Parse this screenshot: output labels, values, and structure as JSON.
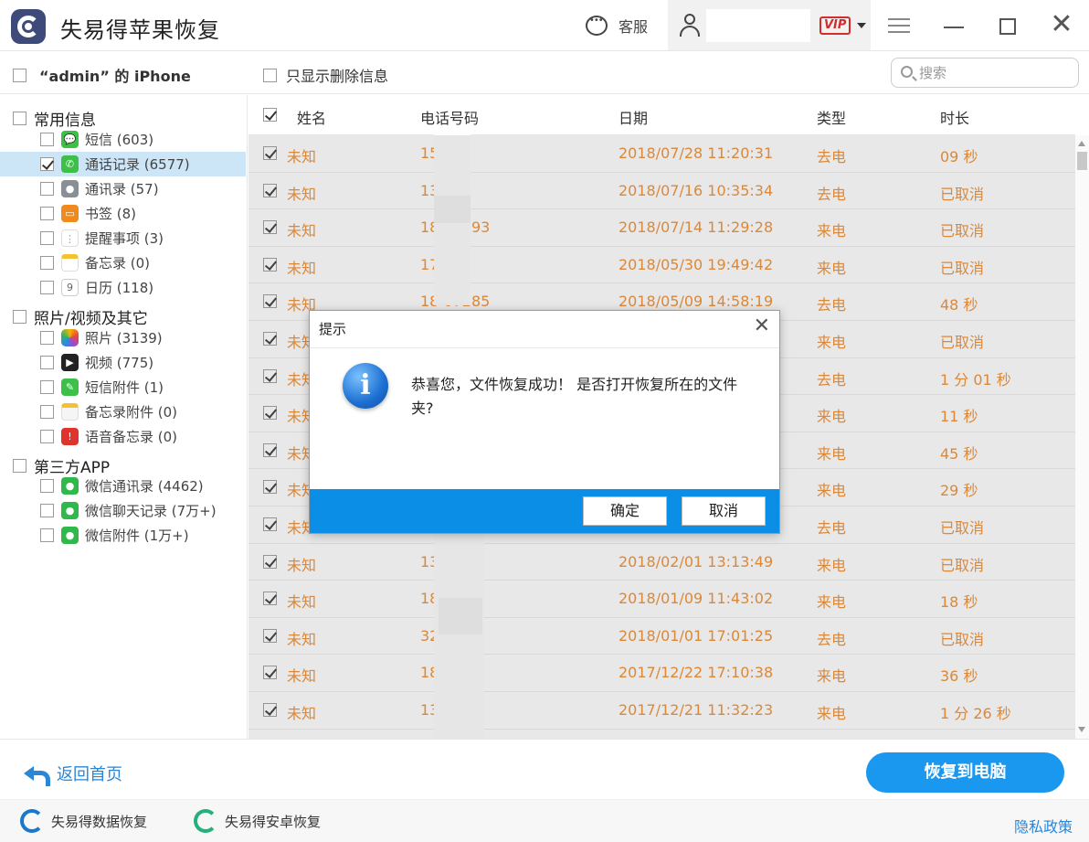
{
  "app": {
    "title": "失易得苹果恢复",
    "service_label": "客服",
    "vip_label": "VIP"
  },
  "toolbar": {
    "device_label": "“admin” 的 iPhone",
    "only_deleted_label": "只显示删除信息",
    "search_placeholder": "搜索"
  },
  "sidebar": {
    "groups": [
      {
        "label": "常用信息"
      },
      {
        "label": "照片/视频及其它"
      },
      {
        "label": "第三方APP"
      }
    ],
    "items": [
      {
        "label": "短信 (603)",
        "icon": "messages-icon",
        "checked": false
      },
      {
        "label": "通话记录 (6577)",
        "icon": "phone-icon",
        "checked": true,
        "selected": true
      },
      {
        "label": "通讯录 (57)",
        "icon": "contacts-icon",
        "checked": false
      },
      {
        "label": "书签 (8)",
        "icon": "bookmark-icon",
        "checked": false
      },
      {
        "label": "提醒事项 (3)",
        "icon": "reminders-icon",
        "checked": false
      },
      {
        "label": "备忘录 (0)",
        "icon": "notes-icon",
        "checked": false
      },
      {
        "label": "日历 (118)",
        "icon": "calendar-icon",
        "checked": false
      },
      {
        "label": "照片 (3139)",
        "icon": "photos-icon",
        "checked": false
      },
      {
        "label": "视频 (775)",
        "icon": "video-icon",
        "checked": false
      },
      {
        "label": "短信附件 (1)",
        "icon": "attachment-icon",
        "checked": false
      },
      {
        "label": "备忘录附件 (0)",
        "icon": "notes-attachment-icon",
        "checked": false
      },
      {
        "label": "语音备忘录 (0)",
        "icon": "voice-memo-icon",
        "checked": false
      },
      {
        "label": "微信通讯录 (4462)",
        "icon": "wechat-contacts-icon",
        "checked": false
      },
      {
        "label": "微信聊天记录 (7万+)",
        "icon": "wechat-chat-icon",
        "checked": false
      },
      {
        "label": "微信附件 (1万+)",
        "icon": "wechat-attachment-icon",
        "checked": false
      }
    ]
  },
  "table": {
    "headers": {
      "name": "姓名",
      "phone": "电话号码",
      "date": "日期",
      "type": "类型",
      "duration": "时长"
    },
    "rows": [
      {
        "name": "未知",
        "phone": "15      91",
        "date": "2018/07/28 11:20:31",
        "type": "去电",
        "duration": "09 秒"
      },
      {
        "name": "未知",
        "phone": "13      000",
        "date": "2018/07/16 10:35:34",
        "type": "去电",
        "duration": "已取消"
      },
      {
        "name": "未知",
        "phone": "18      49193",
        "date": "2018/07/14 11:29:28",
        "type": "来电",
        "duration": "已取消"
      },
      {
        "name": "未知",
        "phone": "17      5",
        "date": "2018/05/30 19:49:42",
        "type": "来电",
        "duration": "已取消"
      },
      {
        "name": "未知",
        "phone": "18      07285",
        "date": "2018/05/09 14:58:19",
        "type": "去电",
        "duration": "48 秒"
      },
      {
        "name": "未知",
        "phone": "",
        "date": "",
        "type": "来电",
        "duration": "已取消"
      },
      {
        "name": "未知",
        "phone": "",
        "date": "",
        "type": "去电",
        "duration": "1 分 01 秒"
      },
      {
        "name": "未知",
        "phone": "",
        "date": "",
        "type": "来电",
        "duration": "11 秒"
      },
      {
        "name": "未知",
        "phone": "",
        "date": "",
        "type": "来电",
        "duration": "45 秒"
      },
      {
        "name": "未知",
        "phone": "",
        "date": "",
        "type": "来电",
        "duration": "29 秒"
      },
      {
        "name": "未知",
        "phone": "",
        "date": "",
        "type": "去电",
        "duration": "已取消"
      },
      {
        "name": "未知",
        "phone": "13      868",
        "date": "2018/02/01 13:13:49",
        "type": "来电",
        "duration": "已取消"
      },
      {
        "name": "未知",
        "phone": "18      28",
        "date": "2018/01/09 11:43:02",
        "type": "来电",
        "duration": "18 秒"
      },
      {
        "name": "未知",
        "phone": "32      4",
        "date": "2018/01/01 17:01:25",
        "type": "去电",
        "duration": "已取消"
      },
      {
        "name": "未知",
        "phone": "18      7588",
        "date": "2017/12/22 17:10:38",
        "type": "来电",
        "duration": "36 秒"
      },
      {
        "name": "未知",
        "phone": "13      0212",
        "date": "2017/12/21 11:32:23",
        "type": "来电",
        "duration": "1 分 26 秒"
      }
    ]
  },
  "dialog": {
    "title": "提示",
    "message": "恭喜您，文件恢复成功！ 是否打开恢复所在的文件夹?",
    "ok_label": "确定",
    "cancel_label": "取消"
  },
  "bottom": {
    "back_label": "返回首页",
    "recover_label": "恢复到电脑"
  },
  "footer": {
    "link1": "失易得数据恢复",
    "link2": "失易得安卓恢复",
    "privacy": "隐私政策"
  },
  "colors": {
    "accent": "#1a97ee",
    "row_text": "#f08a2a",
    "selected_bg": "#cde6f7",
    "vip": "#d42c2c"
  }
}
